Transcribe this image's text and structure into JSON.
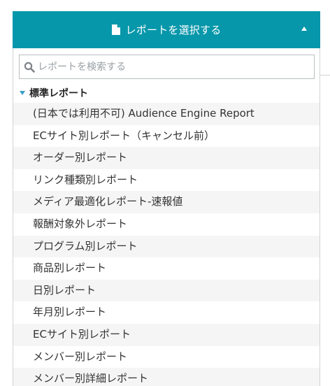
{
  "header": {
    "title": "レポートを選択する",
    "icon": "file-icon",
    "toggle_icon": "caret-up-icon",
    "background_color": "#0797aa"
  },
  "search": {
    "placeholder": "レポートを検索する",
    "value": "",
    "icon": "search-icon"
  },
  "group": {
    "label": "標準レポート",
    "expanded": true,
    "caret_color": "#3a9ec9",
    "items": [
      "(日本では利用不可) Audience Engine Report",
      "ECサイト別レポート（キャンセル前）",
      "オーダー別レポート",
      "リンク種類別レポート",
      "メディア最適化レポート-速報値",
      "報酬対象外レポート",
      "プログラム別レポート",
      "商品別レポート",
      "日別レポート",
      "年月別レポート",
      "ECサイト別レポート",
      "メンバー別レポート",
      "メンバー別詳細レポート"
    ]
  }
}
